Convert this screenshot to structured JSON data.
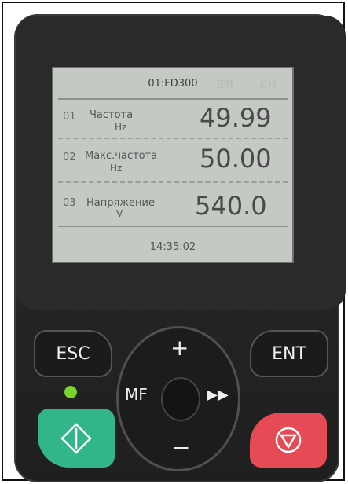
{
  "lcd": {
    "model": "01:FD300",
    "ghost1": "正转",
    "ghost2": "运行",
    "rows": [
      {
        "num": "01",
        "name": "Частота",
        "unit": "Hz",
        "value": "49.99"
      },
      {
        "num": "02",
        "name": "Макс.частота",
        "unit": "Hz",
        "value": "50.00"
      },
      {
        "num": "03",
        "name": "Напряжение",
        "unit": "V",
        "value": "540.0"
      }
    ],
    "time": "14:35:02"
  },
  "keys": {
    "esc": "ESC",
    "ent": "ENT",
    "plus": "+",
    "minus": "−",
    "mf": "MF",
    "ff": "▶▶"
  },
  "colors": {
    "run": "#33b58a",
    "stop": "#e64b55",
    "led": "#7ad32c",
    "lcd": "#c4c9c4"
  },
  "icons": {
    "run": "diamond-run-icon",
    "stop": "circle-triangle-stop-icon"
  }
}
